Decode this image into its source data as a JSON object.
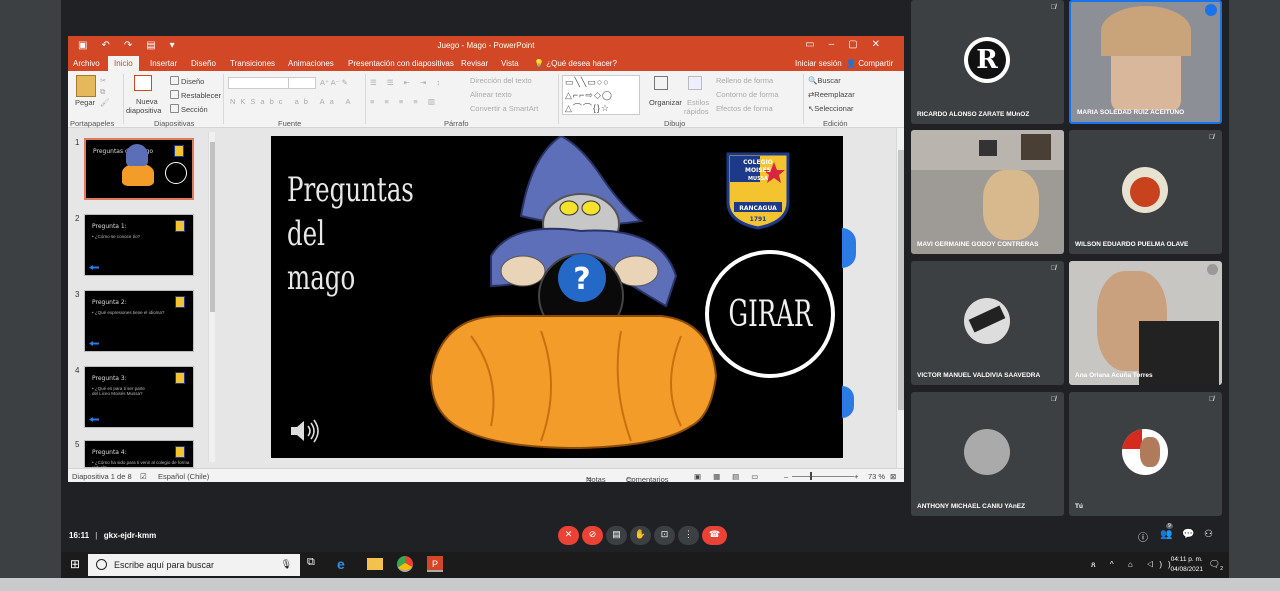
{
  "ppt": {
    "window_title": "Juego - Mago - PowerPoint",
    "tabs": [
      "Archivo",
      "Inicio",
      "Insertar",
      "Diseño",
      "Transiciones",
      "Animaciones",
      "Presentación con diapositivas",
      "Revisar",
      "Vista"
    ],
    "tell_me": "¿Qué desea hacer?",
    "sign_in": "Iniciar sesión",
    "share": "Compartir",
    "ribbon": {
      "paste": "Pegar",
      "new_slide_1": "Nueva",
      "new_slide_2": "diapositiva",
      "layout": "Diseño",
      "reset": "Restablecer",
      "section": "Sección",
      "group_clipboard": "Portapapeles",
      "group_slides": "Diapositivas",
      "group_font": "Fuente",
      "group_paragraph": "Párrafo",
      "group_drawing": "Dibujo",
      "group_editing": "Edición",
      "text_direction": "Dirección del texto",
      "align_text": "Alinear texto",
      "convert_smartart": "Convertir a SmartArt",
      "arrange": "Organizar",
      "quick_styles_1": "Estilos",
      "quick_styles_2": "rápidos",
      "shape_fill": "Relleno de forma",
      "shape_outline": "Contorno de forma",
      "shape_effects": "Efectos de forma",
      "find": "Buscar",
      "replace": "Reemplazar",
      "select": "Seleccionar"
    },
    "thumbnails": [
      {
        "num": "1",
        "title": "Preguntas del mago",
        "sub": ""
      },
      {
        "num": "2",
        "title": "Pregunta 1:",
        "sub": "• ¿Cómo se conoce tío?"
      },
      {
        "num": "3",
        "title": "Pregunta 2:",
        "sub": "• ¿Qué expresiones tiene el idioma?"
      },
      {
        "num": "4",
        "title": "Pregunta 3:",
        "sub": "• ¿Qué es para ti ser parte del Liceo Moisés Mussa?"
      },
      {
        "num": "5",
        "title": "Pregunta 4:",
        "sub": "• ¿Cómo ha sido para ti venir al colegio de forma virtual?"
      }
    ],
    "slide": {
      "title": "Preguntas\ndel mago",
      "button": "GIRAR",
      "crest_line1": "COLEGIO",
      "crest_line2": "MOISES",
      "crest_line3": "MUSSA",
      "crest_city": "RANCAGUA",
      "crest_year": "1791"
    },
    "status": {
      "slide_of": "Diapositiva 1 de 8",
      "language": "Español (Chile)",
      "notes": "Notas",
      "comments": "Comentarios",
      "zoom": "73 %"
    }
  },
  "participants": [
    {
      "name": "RICARDO ALONSO ZARATE MUnOZ",
      "muted": true
    },
    {
      "name": "MARIA SOLEDAD RUIZ ACEITUNO",
      "muted": false
    },
    {
      "name": "MAVI GERMAINE GODOY CONTRERAS",
      "muted": false
    },
    {
      "name": "WILSON EDUARDO PUELMA OLAVE",
      "muted": true
    },
    {
      "name": "VICTOR MANUEL VALDIVIA SAAVEDRA",
      "muted": true
    },
    {
      "name": "Ana Oriana Acuña Torres",
      "muted": false
    },
    {
      "name": "ANTHONY MICHAEL CANIU YAnEZ",
      "muted": true
    },
    {
      "name": "Tú",
      "muted": true
    }
  ],
  "meet": {
    "time": "16:11",
    "separator": "|",
    "code": "gkx-ejdr-kmm",
    "people_count": "9"
  },
  "taskbar": {
    "search_placeholder": "Escribe aquí para buscar",
    "clock_time": "04:11 p. m.",
    "clock_date": "04/08/2021",
    "notifications": "2"
  },
  "colors": {
    "ppt_accent": "#d24726",
    "meet_bg": "#202124",
    "tile_bg": "#3c4043",
    "hangup_red": "#ea4335",
    "speaking_blue": "#1a73e8"
  }
}
